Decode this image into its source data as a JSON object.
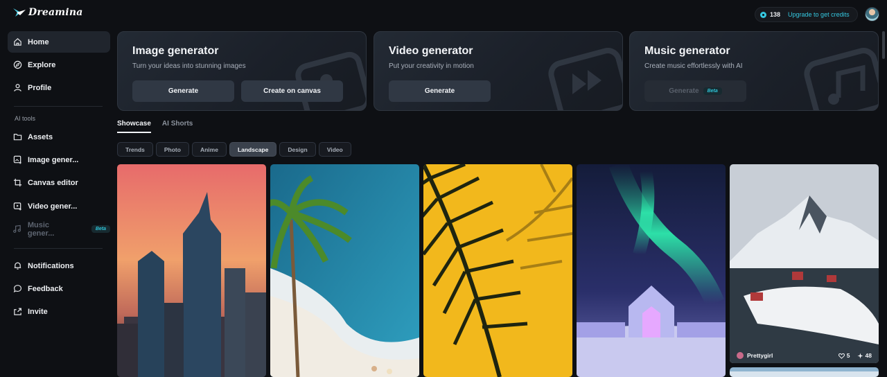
{
  "app": {
    "name": "Dreamina"
  },
  "topbar": {
    "credits": "138",
    "upgrade_label": "Upgrade to get credits"
  },
  "sidebar": {
    "items": [
      {
        "label": "Home",
        "icon": "home-icon"
      },
      {
        "label": "Explore",
        "icon": "compass-icon"
      },
      {
        "label": "Profile",
        "icon": "user-icon"
      }
    ],
    "section_label": "AI tools",
    "tools": [
      {
        "label": "Assets",
        "icon": "folder-icon"
      },
      {
        "label": "Image gener...",
        "icon": "image-plus-icon"
      },
      {
        "label": "Canvas editor",
        "icon": "crop-icon"
      },
      {
        "label": "Video gener...",
        "icon": "video-icon"
      },
      {
        "label": "Music gener...",
        "icon": "music-icon",
        "badge": "Beta"
      }
    ],
    "footer_items": [
      {
        "label": "Notifications",
        "icon": "bell-icon"
      },
      {
        "label": "Feedback",
        "icon": "message-icon"
      },
      {
        "label": "Invite",
        "icon": "share-icon"
      }
    ]
  },
  "cards": [
    {
      "title": "Image generator",
      "subtitle": "Turn your ideas into stunning images",
      "buttons": [
        "Generate",
        "Create on canvas"
      ]
    },
    {
      "title": "Video generator",
      "subtitle": "Put your creativity in motion",
      "buttons": [
        "Generate"
      ]
    },
    {
      "title": "Music generator",
      "subtitle": "Create music effortlessly with AI",
      "buttons": [
        "Generate"
      ],
      "badge": "Beta"
    }
  ],
  "tabs": [
    "Showcase",
    "AI Shorts"
  ],
  "chips": [
    "Trends",
    "Photo",
    "Anime",
    "Landscape",
    "Design",
    "Video"
  ],
  "active_chip": "Landscape",
  "gallery": {
    "tiles": [
      {
        "subject": "city-sunset-skyline"
      },
      {
        "subject": "palm-beach-ocean"
      },
      {
        "subject": "palm-leaf-yellow"
      },
      {
        "subject": "aurora-ice-palace"
      },
      {
        "subject": "snowy-mountain-village",
        "author": "Prettygirl",
        "likes": "5",
        "remixes": "48"
      }
    ]
  },
  "colors": {
    "accent": "#35c8e0",
    "background": "#0e1014",
    "card": "#1e242d"
  }
}
